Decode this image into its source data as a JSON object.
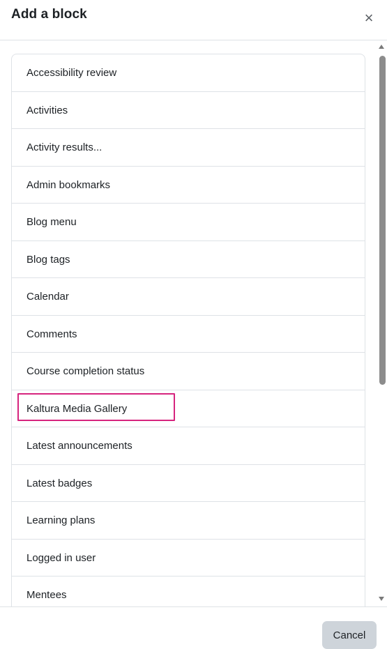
{
  "dialog": {
    "title": "Add a block",
    "close_symbol": "×"
  },
  "blocks": [
    {
      "label": "Accessibility review"
    },
    {
      "label": "Activities"
    },
    {
      "label": "Activity results..."
    },
    {
      "label": "Admin bookmarks"
    },
    {
      "label": "Blog menu"
    },
    {
      "label": "Blog tags"
    },
    {
      "label": "Calendar"
    },
    {
      "label": "Comments"
    },
    {
      "label": "Course completion status"
    },
    {
      "label": "Kaltura Media Gallery",
      "highlighted": true
    },
    {
      "label": "Latest announcements"
    },
    {
      "label": "Latest badges"
    },
    {
      "label": "Learning plans"
    },
    {
      "label": "Logged in user"
    },
    {
      "label": "Mentees"
    }
  ],
  "footer": {
    "cancel_label": "Cancel"
  },
  "colors": {
    "highlight_border": "#d6247e",
    "cancel_background": "#ced4da"
  }
}
